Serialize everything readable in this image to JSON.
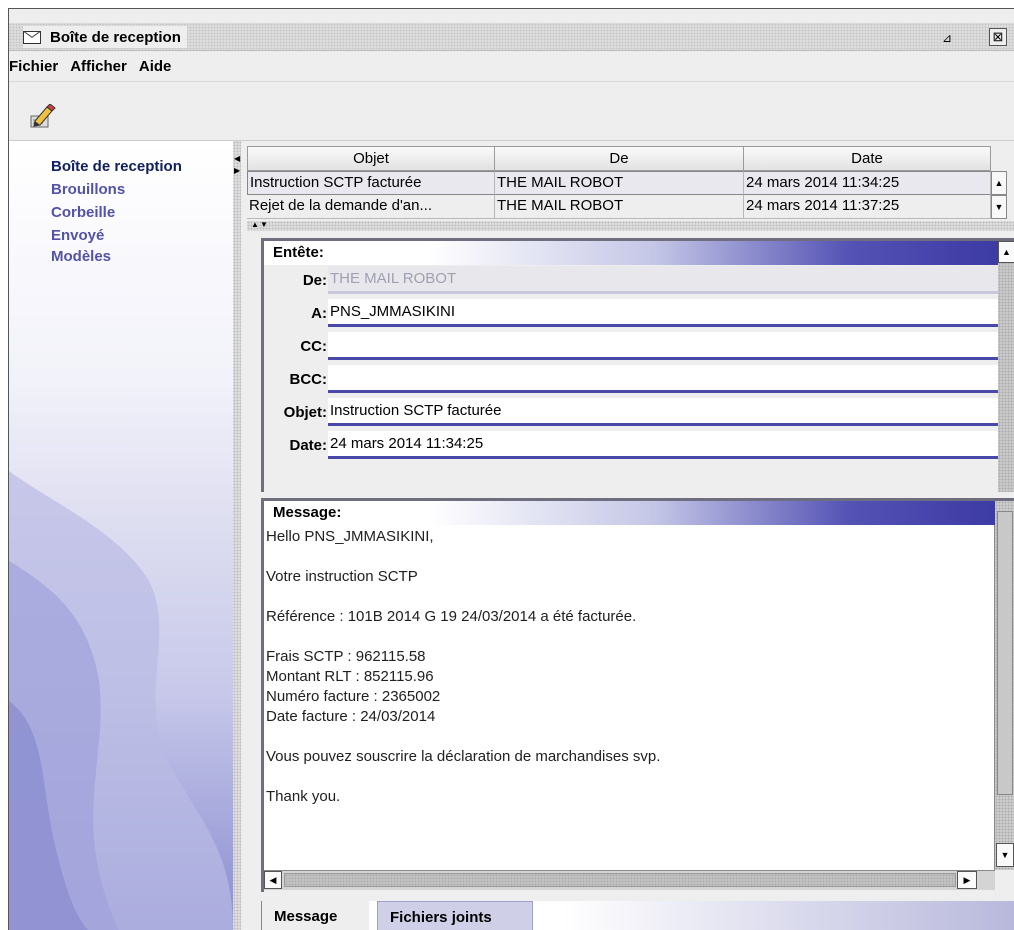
{
  "window": {
    "title": "Boîte de reception",
    "restore_glyph": "⊿",
    "close_glyph": "⊠"
  },
  "menu": {
    "items": [
      "Fichier",
      "Afficher",
      "Aide"
    ]
  },
  "toolbar": {
    "compose_icon": "pencil-compose-icon"
  },
  "sidebar": {
    "folders": [
      "Boîte de reception",
      "Brouillons",
      "Corbeille",
      "Envoyé",
      "Modèles"
    ],
    "selected": "Boîte de reception"
  },
  "table": {
    "columns": [
      "Objet",
      "De",
      "Date"
    ],
    "rows": [
      {
        "objet": "Instruction SCTP facturée",
        "de": "THE MAIL ROBOT",
        "date": "24 mars 2014 11:34:25"
      },
      {
        "objet": "Rejet de la demande d'an...",
        "de": "THE MAIL ROBOT",
        "date": "24 mars 2014 11:37:25"
      }
    ]
  },
  "header": {
    "title": "Entête:",
    "fields": [
      {
        "label": "De:",
        "value": "THE MAIL ROBOT"
      },
      {
        "label": "A:",
        "value": "PNS_JMMASIKINI"
      },
      {
        "label": "CC:",
        "value": ""
      },
      {
        "label": "BCC:",
        "value": ""
      },
      {
        "label": "Objet:",
        "value": "Instruction SCTP facturée"
      },
      {
        "label": "Date:",
        "value": "24 mars 2014 11:34:25"
      }
    ]
  },
  "message": {
    "title": "Message:",
    "lines": [
      "Hello PNS_JMMASIKINI,",
      "",
      "Votre instruction SCTP",
      "",
      "Référence : 101B 2014 G 19 24/03/2014 a été facturée.",
      "",
      "Frais SCTP : 962115.58",
      "Montant RLT : 852115.96",
      "Numéro facture : 2365002",
      "Date facture : 24/03/2014",
      "",
      "Vous pouvez souscrire la déclaration de marchandises svp.",
      "",
      "Thank you."
    ]
  },
  "tabs": [
    "Message",
    "Fichiers joints"
  ],
  "colors": {
    "accent": "#3a38a2",
    "folder_text": "#5252a8"
  }
}
